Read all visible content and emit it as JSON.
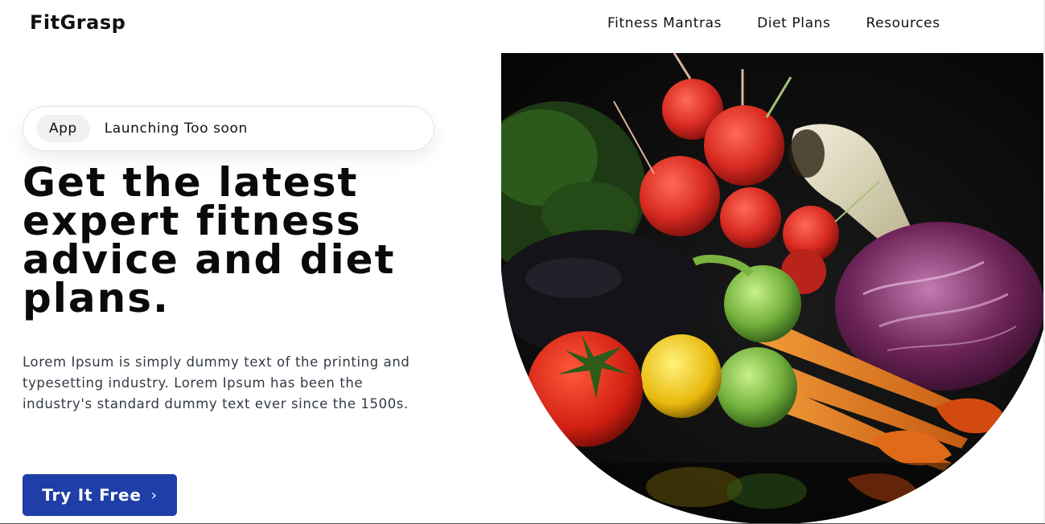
{
  "header": {
    "logo": "FitGrasp",
    "nav": [
      "Fitness Mantras",
      "Diet Plans",
      "Resources"
    ]
  },
  "announcement": {
    "tag": "App",
    "text": "Launching Too soon"
  },
  "hero": {
    "headline": "Get the latest expert fitness advice and diet plans.",
    "description": "Lorem Ipsum is simply dummy text of the printing and typesetting industry. Lorem Ipsum has been the industry's standard dummy text ever since the 1500s.",
    "cta_label": "Try It Free",
    "cta_color": "#1f3ea8",
    "image": "vegetables-photo"
  }
}
